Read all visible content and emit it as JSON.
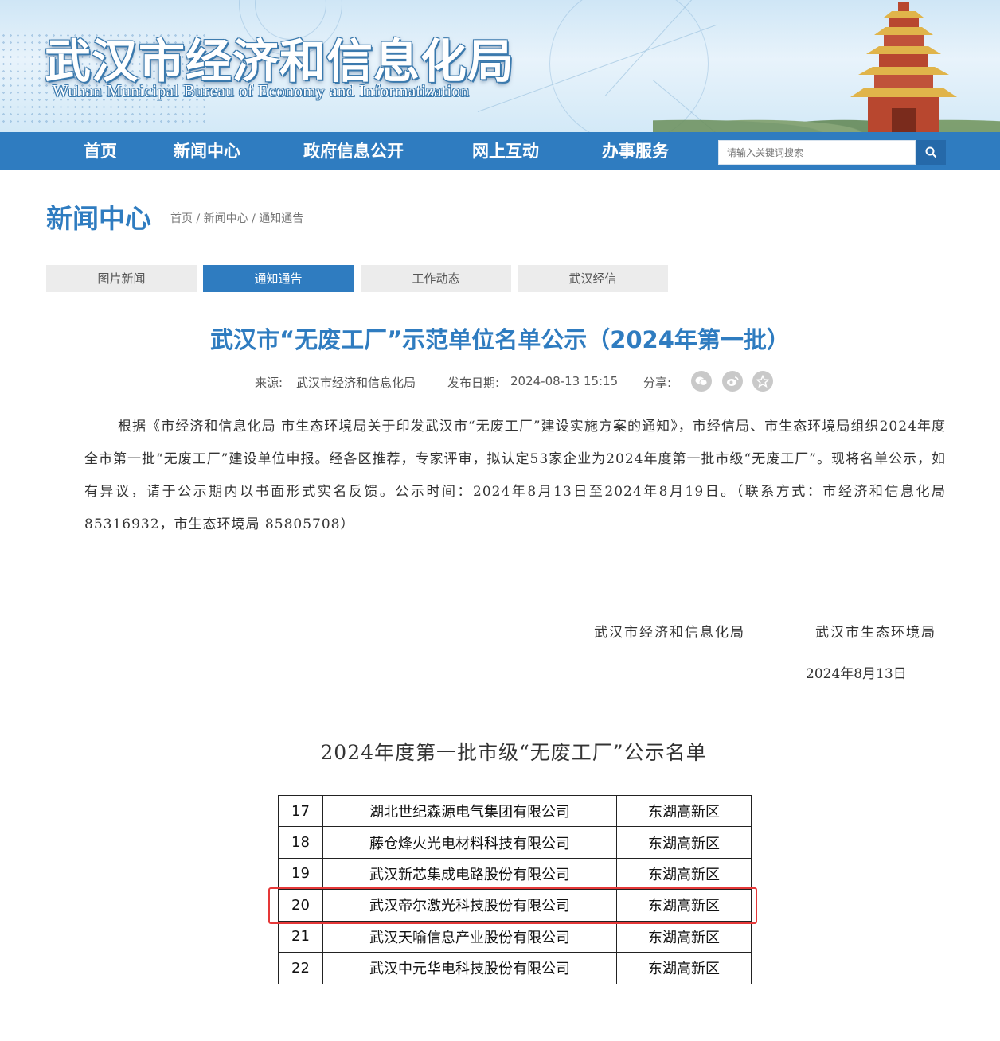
{
  "header": {
    "title": "武汉市经济和信息化局",
    "subtitle": "Wuhan Municipal Bureau of Economy and Informatization"
  },
  "nav": {
    "items": [
      "首页",
      "新闻中心",
      "政府信息公开",
      "网上互动",
      "办事服务"
    ],
    "search_placeholder": "请输入关键词搜索"
  },
  "section": {
    "title": "新闻中心",
    "breadcrumb": [
      "首页",
      "新闻中心",
      "通知通告"
    ]
  },
  "tabs": [
    {
      "label": "图片新闻",
      "active": false
    },
    {
      "label": "通知通告",
      "active": true
    },
    {
      "label": "工作动态",
      "active": false
    },
    {
      "label": "武汉经信",
      "active": false
    }
  ],
  "article": {
    "title": "武汉市“无废工厂”示范单位名单公示（2024年第一批）",
    "source_label": "来源:",
    "source": "武汉市经济和信息化局",
    "date_label": "发布日期:",
    "date": "2024-08-13 15:15",
    "share_label": "分享:",
    "share_icons": [
      "wechat-icon",
      "weibo-icon",
      "favorite-icon"
    ],
    "body": "根据《市经济和信息化局 市生态环境局关于印发武汉市“无废工厂”建设实施方案的通知》，市经信局、市生态环境局组织2024年度全市第一批“无废工厂”建设单位申报。经各区推荐，专家评审，拟认定53家企业为2024年度第一批市级“无废工厂”。现将名单公示，如有异议，请于公示期内以书面形式实名反馈。公示时间：2024年8月13日至2024年8月19日。（联系方式：市经济和信息化局 85316932，市生态环境局 85805708）",
    "signers": [
      "武汉市经济和信息化局",
      "武汉市生态环境局"
    ],
    "sign_date": "2024年8月13日",
    "list_title": "2024年度第一批市级“无废工厂”公示名单"
  },
  "table": {
    "rows": [
      {
        "no": "17",
        "name": "湖北世纪森源电气集团有限公司",
        "area": "东湖高新区"
      },
      {
        "no": "18",
        "name": "藤仓烽火光电材料科技有限公司",
        "area": "东湖高新区"
      },
      {
        "no": "19",
        "name": "武汉新芯集成电路股份有限公司",
        "area": "东湖高新区"
      },
      {
        "no": "20",
        "name": "武汉帝尔激光科技股份有限公司",
        "area": "东湖高新区"
      },
      {
        "no": "21",
        "name": "武汉天喻信息产业股份有限公司",
        "area": "东湖高新区"
      },
      {
        "no": "22",
        "name": "武汉中元华电科技股份有限公司",
        "area": "东湖高新区"
      }
    ],
    "highlighted_row": "20",
    "highlight_color": "#e53838"
  },
  "colors": {
    "brand_blue": "#2f7cc0",
    "nav_bg": "#2f7cc0"
  }
}
